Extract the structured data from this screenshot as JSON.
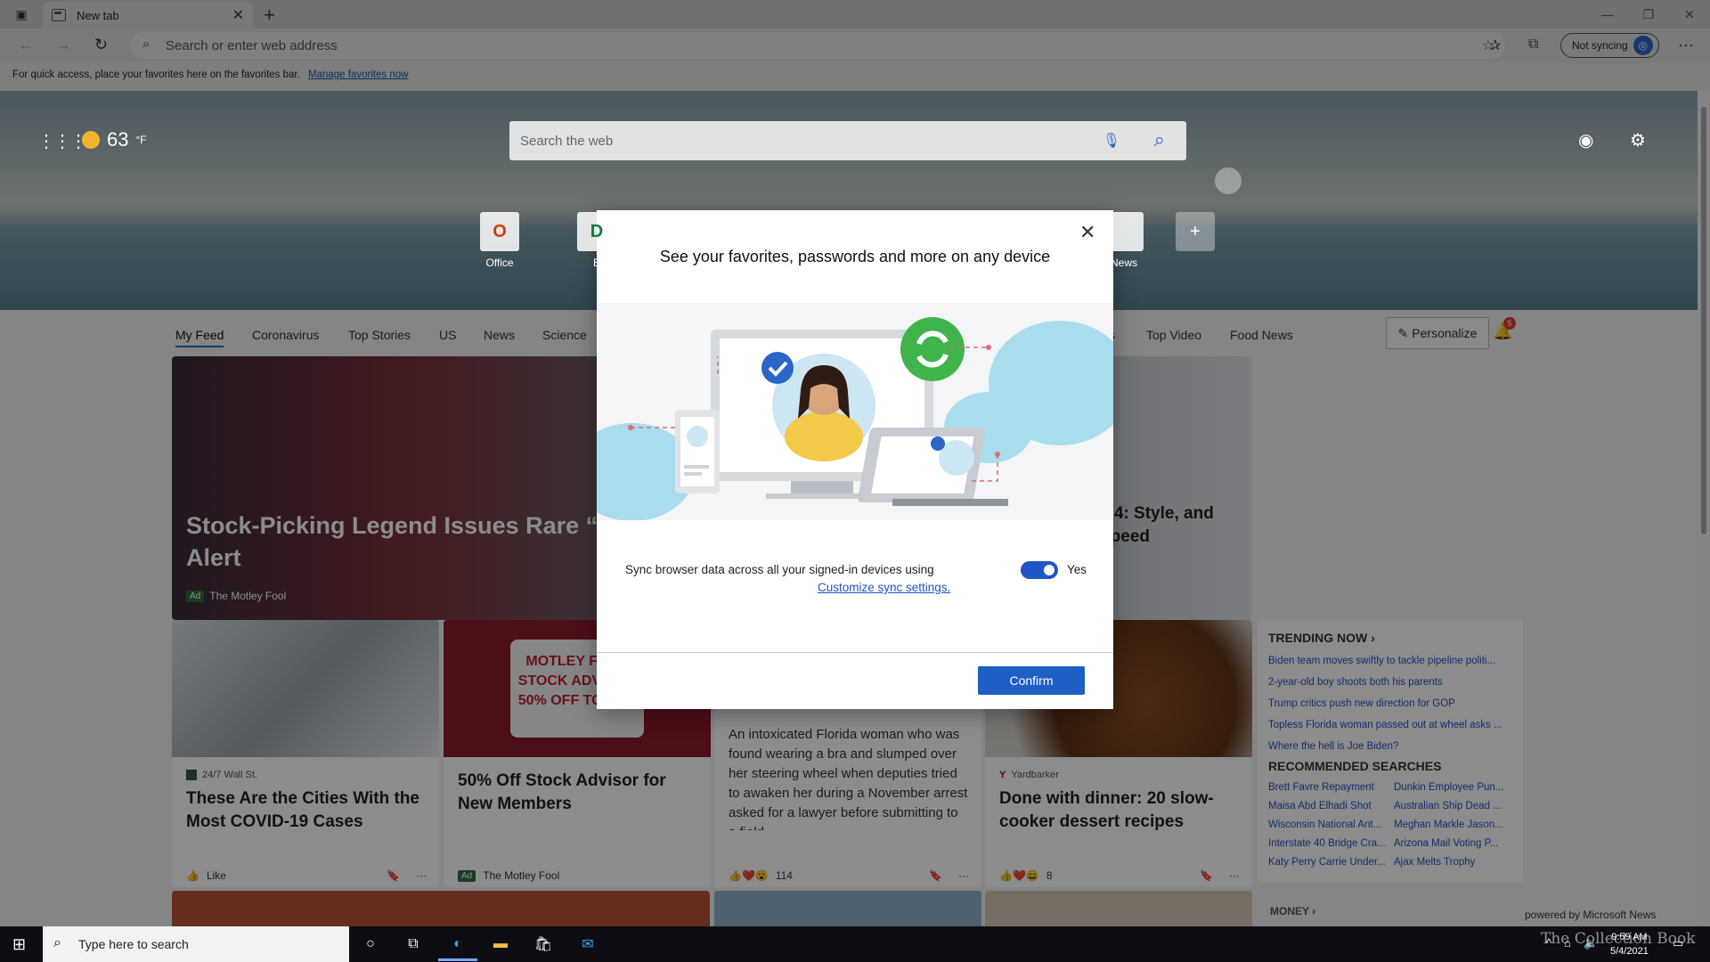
{
  "tab": {
    "title": "New tab",
    "close": "✕",
    "new": "+"
  },
  "window_controls": [
    "—",
    "❐",
    "✕"
  ],
  "toolbar": {
    "address_placeholder": "Search or enter web address",
    "not_syncing": "Not syncing"
  },
  "favbar": {
    "text": "For quick access, place your favorites here on the favorites bar.",
    "link": "Manage favorites now"
  },
  "weather": {
    "temp": "63",
    "unit": "°F"
  },
  "websearch": {
    "placeholder": "Search the web"
  },
  "quicklinks": [
    {
      "label": "Office",
      "letter": "O"
    },
    {
      "label": "B",
      "letter": "D"
    },
    {
      "label": "News",
      "letter": ""
    }
  ],
  "feed_nav": {
    "items": [
      "My Feed",
      "Coronavirus",
      "Top Stories",
      "US",
      "News",
      "Science",
      "s",
      "Top Video",
      "Food News"
    ],
    "personalize": "Personalize",
    "notifications": "5"
  },
  "hero": {
    "title": "Stock-Picking Legend Issues Rare “Al Alert",
    "ad": "Ad",
    "source": "The Motley Fool",
    "right_title": "o 4: Style, and Speed"
  },
  "cards": [
    {
      "source": "24/7 Wall St.",
      "title": "These Are the Cities With the Most COVID-19 Cases",
      "like": "Like"
    },
    {
      "title": "50% Off Stock Advisor for New Members",
      "ad": "Ad",
      "source": "The Motley Fool",
      "img_text": "MOTLEY FOOL STOCK ADVISOR 50% OFF TODAY!"
    },
    {
      "body": "An intoxicated Florida woman who was found wearing a bra and slumped over her steering wheel when deputies tried to awaken her during a November arrest asked for a lawyer before submitting to a field",
      "reactions": "114"
    },
    {
      "source": "Yardbarker",
      "title": "Done with dinner: 20 slow-cooker dessert recipes",
      "reactions": "8"
    }
  ],
  "trending": {
    "heading": "TRENDING NOW",
    "items": [
      "Biden team moves swiftly to tackle pipeline politi...",
      "2-year-old boy shoots both his parents",
      "Trump critics push new direction for GOP",
      "Topless Florida woman passed out at wheel asks ...",
      "Where the hell is Joe Biden?"
    ],
    "rec_heading": "RECOMMENDED SEARCHES",
    "rec": [
      "Brett Favre Repayment",
      "Dunkin Employee Pun...",
      "Maisa Abd Elhadi Shot",
      "Australian Ship Dead ...",
      "Wisconsin National Ant...",
      "Meghan Markle Jason...",
      "Interstate 40 Bridge Cra...",
      "Arizona Mail Voting P...",
      "Katy Perry Carrie Under...",
      "Ajax Melts Trophy"
    ]
  },
  "money": "MONEY",
  "powered": "powered by Microsoft News",
  "dialog": {
    "title": "See your favorites, passwords and more on any device",
    "sync_text": "Sync browser data across all your signed-in devices using",
    "link": "Customize sync settings.",
    "toggle_label": "Yes",
    "confirm": "Confirm"
  },
  "taskbar": {
    "search_placeholder": "Type here to search",
    "time": "9:59 AM",
    "date": "5/4/2021"
  },
  "watermark": "The Collection Book",
  "colors": {
    "accent": "#1e5fc6",
    "link": "#1e55c7",
    "taskbar": "#0c0e14"
  }
}
